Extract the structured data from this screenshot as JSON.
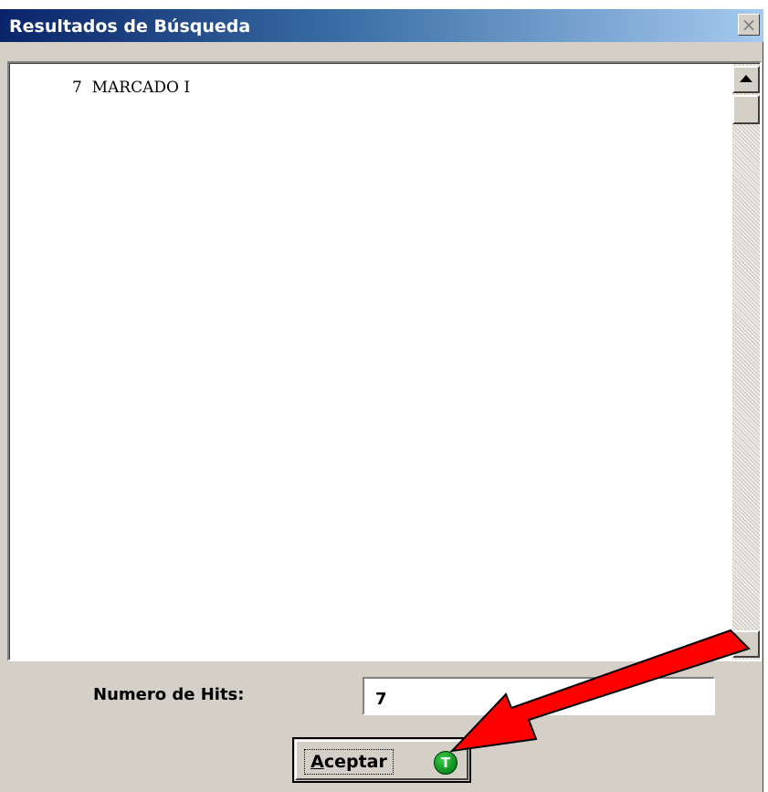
{
  "window": {
    "title": "Resultados de Búsqueda",
    "close_glyph": "×"
  },
  "results": {
    "items": [
      "7  MARCADO I"
    ]
  },
  "hits": {
    "label": "Numero de Hits:",
    "value": "7"
  },
  "accept_button": {
    "accel": "A",
    "rest": "ceptar",
    "icon_glyph": "T"
  },
  "icons": {
    "close": "close-icon",
    "scroll_up": "scroll-up-arrow-icon",
    "accept": "green-circle-t-icon",
    "annotation": "red-arrow-icon"
  },
  "colors": {
    "annotation_arrow": "#ff0000",
    "accept_icon": "#0c8a1c",
    "title_gradient_start": "#0a246a",
    "title_gradient_end": "#a6caf0"
  }
}
